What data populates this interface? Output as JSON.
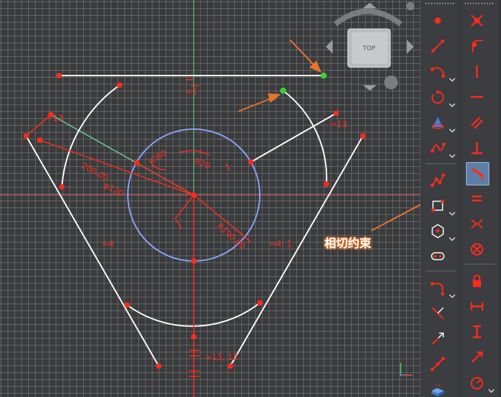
{
  "navcube": {
    "face_label": "TOP"
  },
  "annotation": {
    "text": "相切约束",
    "color": "#e8742a"
  },
  "colors": {
    "grid": "#c8c8c8",
    "sketch_geometry": "#ffffff",
    "constraint": "#ff2a1a",
    "circle": "#8da2ff",
    "construction": "#6fd29a",
    "x_axis": "#d85a5a",
    "y_axis": "#4ecb71",
    "selected_point": "#3ad13a",
    "active_tool": "#5d7ea7"
  },
  "dimensions": {
    "radius_dim_a": "∅60",
    "radius_dim_b": "R20",
    "angle_left": "φ120",
    "distance_left": "200.00",
    "distance_right": "R190.00"
  },
  "constraint_labels": {
    "eq_top": "=1",
    "eq_right": "=13",
    "eq_left": "=4",
    "eq_mid": "=4, 1",
    "eq_bottom": "=13, 12",
    "tan_label": "⊤13"
  },
  "toolbar_left": [
    {
      "name": "point-tool-icon",
      "dropdown": false
    },
    {
      "name": "line-tool-icon",
      "dropdown": false
    },
    {
      "name": "arc-tool-icon",
      "dropdown": true
    },
    {
      "name": "circle-tool-icon",
      "dropdown": true
    },
    {
      "name": "conic-tool-icon",
      "dropdown": true
    },
    {
      "name": "bspline-tool-icon",
      "dropdown": true
    },
    {
      "name": "polyline-tool-icon",
      "dropdown": false
    },
    {
      "name": "rectangle-tool-icon",
      "dropdown": true
    },
    {
      "name": "polygon-tool-icon",
      "dropdown": true
    },
    {
      "name": "slot-tool-icon",
      "dropdown": false
    },
    {
      "name": "fillet-tool-icon",
      "dropdown": true
    },
    {
      "name": "trim-tool-icon",
      "dropdown": false
    },
    {
      "name": "extend-tool-icon",
      "dropdown": false
    },
    {
      "name": "external-geometry-tool-icon",
      "dropdown": false
    },
    {
      "name": "carbon-copy-tool-icon",
      "dropdown": false
    }
  ],
  "toolbar_right": [
    {
      "name": "coincident-constraint-icon"
    },
    {
      "name": "point-on-object-constraint-icon"
    },
    {
      "name": "vertical-constraint-icon"
    },
    {
      "name": "horizontal-constraint-icon"
    },
    {
      "name": "parallel-constraint-icon"
    },
    {
      "name": "perpendicular-constraint-icon"
    },
    {
      "name": "tangent-constraint-icon",
      "active": true
    },
    {
      "name": "equal-constraint-icon"
    },
    {
      "name": "symmetric-constraint-icon"
    },
    {
      "name": "block-constraint-icon"
    },
    {
      "name": "lock-constraint-icon"
    },
    {
      "name": "horizontal-distance-constraint-icon"
    },
    {
      "name": "vertical-distance-constraint-icon"
    },
    {
      "name": "distance-constraint-icon"
    },
    {
      "name": "radius-constraint-icon",
      "dropdown": true
    }
  ]
}
